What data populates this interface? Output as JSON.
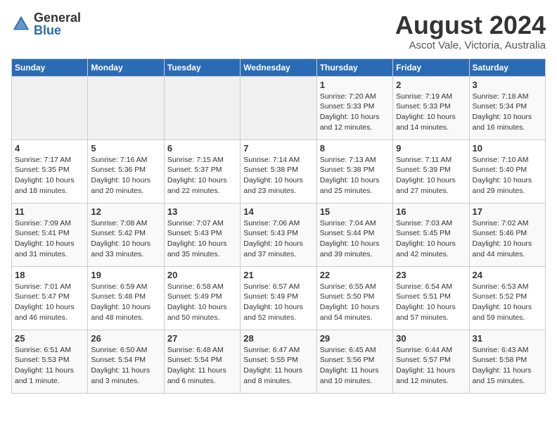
{
  "header": {
    "logo_general": "General",
    "logo_blue": "Blue",
    "month_year": "August 2024",
    "location": "Ascot Vale, Victoria, Australia"
  },
  "days_of_week": [
    "Sunday",
    "Monday",
    "Tuesday",
    "Wednesday",
    "Thursday",
    "Friday",
    "Saturday"
  ],
  "weeks": [
    [
      {
        "day": "",
        "info": ""
      },
      {
        "day": "",
        "info": ""
      },
      {
        "day": "",
        "info": ""
      },
      {
        "day": "",
        "info": ""
      },
      {
        "day": "1",
        "info": "Sunrise: 7:20 AM\nSunset: 5:33 PM\nDaylight: 10 hours\nand 12 minutes."
      },
      {
        "day": "2",
        "info": "Sunrise: 7:19 AM\nSunset: 5:33 PM\nDaylight: 10 hours\nand 14 minutes."
      },
      {
        "day": "3",
        "info": "Sunrise: 7:18 AM\nSunset: 5:34 PM\nDaylight: 10 hours\nand 16 minutes."
      }
    ],
    [
      {
        "day": "4",
        "info": "Sunrise: 7:17 AM\nSunset: 5:35 PM\nDaylight: 10 hours\nand 18 minutes."
      },
      {
        "day": "5",
        "info": "Sunrise: 7:16 AM\nSunset: 5:36 PM\nDaylight: 10 hours\nand 20 minutes."
      },
      {
        "day": "6",
        "info": "Sunrise: 7:15 AM\nSunset: 5:37 PM\nDaylight: 10 hours\nand 22 minutes."
      },
      {
        "day": "7",
        "info": "Sunrise: 7:14 AM\nSunset: 5:38 PM\nDaylight: 10 hours\nand 23 minutes."
      },
      {
        "day": "8",
        "info": "Sunrise: 7:13 AM\nSunset: 5:38 PM\nDaylight: 10 hours\nand 25 minutes."
      },
      {
        "day": "9",
        "info": "Sunrise: 7:11 AM\nSunset: 5:39 PM\nDaylight: 10 hours\nand 27 minutes."
      },
      {
        "day": "10",
        "info": "Sunrise: 7:10 AM\nSunset: 5:40 PM\nDaylight: 10 hours\nand 29 minutes."
      }
    ],
    [
      {
        "day": "11",
        "info": "Sunrise: 7:09 AM\nSunset: 5:41 PM\nDaylight: 10 hours\nand 31 minutes."
      },
      {
        "day": "12",
        "info": "Sunrise: 7:08 AM\nSunset: 5:42 PM\nDaylight: 10 hours\nand 33 minutes."
      },
      {
        "day": "13",
        "info": "Sunrise: 7:07 AM\nSunset: 5:43 PM\nDaylight: 10 hours\nand 35 minutes."
      },
      {
        "day": "14",
        "info": "Sunrise: 7:06 AM\nSunset: 5:43 PM\nDaylight: 10 hours\nand 37 minutes."
      },
      {
        "day": "15",
        "info": "Sunrise: 7:04 AM\nSunset: 5:44 PM\nDaylight: 10 hours\nand 39 minutes."
      },
      {
        "day": "16",
        "info": "Sunrise: 7:03 AM\nSunset: 5:45 PM\nDaylight: 10 hours\nand 42 minutes."
      },
      {
        "day": "17",
        "info": "Sunrise: 7:02 AM\nSunset: 5:46 PM\nDaylight: 10 hours\nand 44 minutes."
      }
    ],
    [
      {
        "day": "18",
        "info": "Sunrise: 7:01 AM\nSunset: 5:47 PM\nDaylight: 10 hours\nand 46 minutes."
      },
      {
        "day": "19",
        "info": "Sunrise: 6:59 AM\nSunset: 5:48 PM\nDaylight: 10 hours\nand 48 minutes."
      },
      {
        "day": "20",
        "info": "Sunrise: 6:58 AM\nSunset: 5:49 PM\nDaylight: 10 hours\nand 50 minutes."
      },
      {
        "day": "21",
        "info": "Sunrise: 6:57 AM\nSunset: 5:49 PM\nDaylight: 10 hours\nand 52 minutes."
      },
      {
        "day": "22",
        "info": "Sunrise: 6:55 AM\nSunset: 5:50 PM\nDaylight: 10 hours\nand 54 minutes."
      },
      {
        "day": "23",
        "info": "Sunrise: 6:54 AM\nSunset: 5:51 PM\nDaylight: 10 hours\nand 57 minutes."
      },
      {
        "day": "24",
        "info": "Sunrise: 6:53 AM\nSunset: 5:52 PM\nDaylight: 10 hours\nand 59 minutes."
      }
    ],
    [
      {
        "day": "25",
        "info": "Sunrise: 6:51 AM\nSunset: 5:53 PM\nDaylight: 11 hours\nand 1 minute."
      },
      {
        "day": "26",
        "info": "Sunrise: 6:50 AM\nSunset: 5:54 PM\nDaylight: 11 hours\nand 3 minutes."
      },
      {
        "day": "27",
        "info": "Sunrise: 6:48 AM\nSunset: 5:54 PM\nDaylight: 11 hours\nand 6 minutes."
      },
      {
        "day": "28",
        "info": "Sunrise: 6:47 AM\nSunset: 5:55 PM\nDaylight: 11 hours\nand 8 minutes."
      },
      {
        "day": "29",
        "info": "Sunrise: 6:45 AM\nSunset: 5:56 PM\nDaylight: 11 hours\nand 10 minutes."
      },
      {
        "day": "30",
        "info": "Sunrise: 6:44 AM\nSunset: 5:57 PM\nDaylight: 11 hours\nand 12 minutes."
      },
      {
        "day": "31",
        "info": "Sunrise: 6:43 AM\nSunset: 5:58 PM\nDaylight: 11 hours\nand 15 minutes."
      }
    ]
  ]
}
